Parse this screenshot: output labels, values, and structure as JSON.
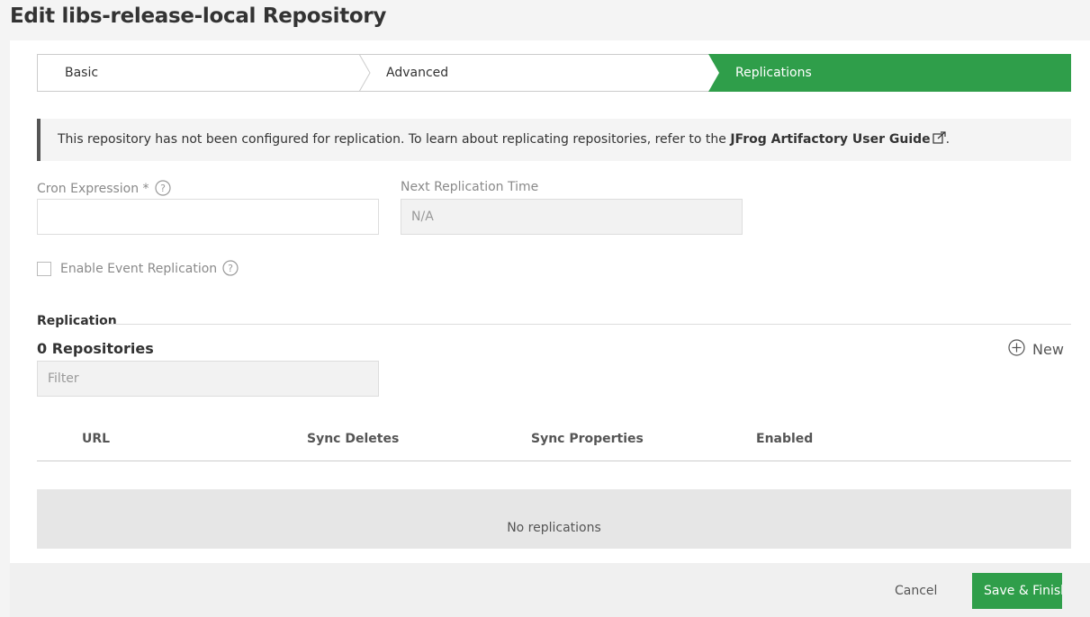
{
  "page": {
    "title": "Edit libs-release-local Repository"
  },
  "wizard": {
    "steps": [
      {
        "label": "Basic",
        "active": false
      },
      {
        "label": "Advanced",
        "active": false
      },
      {
        "label": "Replications",
        "active": true
      }
    ]
  },
  "info": {
    "text": "This repository has not been configured for replication. To learn about replicating repositories, refer to the ",
    "link_text": "JFrog Artifactory User Guide",
    "end": "."
  },
  "form": {
    "cron_label": "Cron Expression *",
    "cron_value": "",
    "next_time_label": "Next Replication Time",
    "next_time_value": "N/A",
    "event_replication_label": "Enable Event Replication",
    "event_replication_checked": false
  },
  "replication": {
    "section_title": "Replication",
    "count_label": "0 Repositories",
    "new_label": "New",
    "filter_placeholder": "Filter",
    "columns": [
      "URL",
      "Sync Deletes",
      "Sync Properties",
      "Enabled"
    ],
    "empty_text": "No replications"
  },
  "footer": {
    "cancel_label": "Cancel",
    "save_label": "Save & Finish"
  },
  "colors": {
    "accent": "#2f9e4a",
    "banner_bg": "#f4f4f4",
    "empty_row_bg": "#e6e6e6"
  }
}
